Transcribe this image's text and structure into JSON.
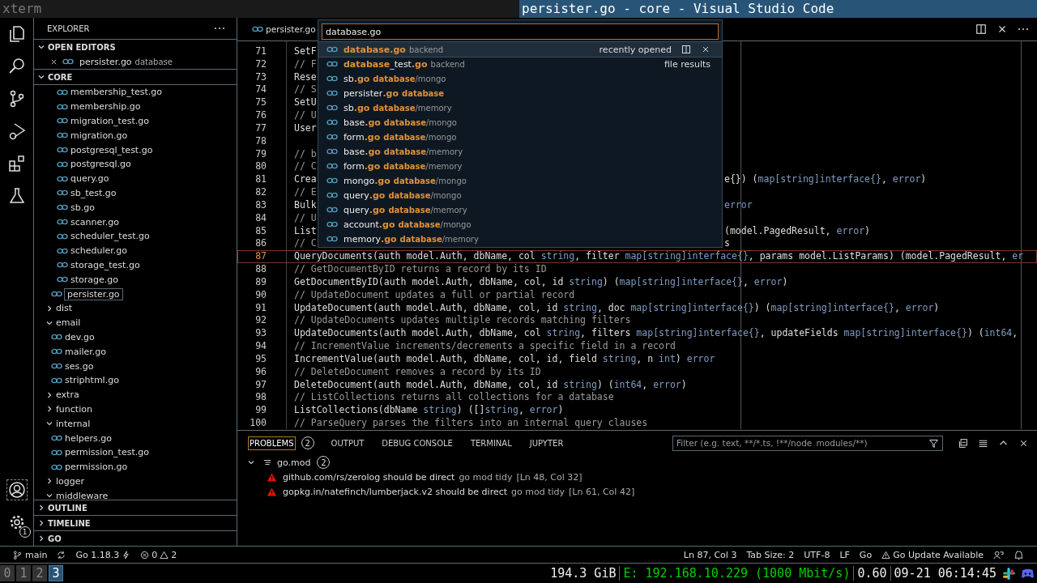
{
  "top_bar": {
    "app": "xterm",
    "title": "persister.go - core - Visual Studio Code"
  },
  "activity_bar": {
    "settings_badge": "1"
  },
  "sidebar": {
    "title": "EXPLORER",
    "open_editors": {
      "label": "OPEN EDITORS",
      "expanded": true,
      "items": [
        {
          "name": "persister.go",
          "folder": "database"
        }
      ]
    },
    "workspace": {
      "label": "CORE",
      "expanded": true,
      "tree": [
        {
          "children": [
            {
              "children": [
                {
                  "kind": "file",
                  "name": "membership_test.go",
                  "selected": false
                },
                {
                  "kind": "file",
                  "name": "membership.go",
                  "selected": false
                },
                {
                  "kind": "file",
                  "name": "migration_test.go",
                  "selected": false
                },
                {
                  "kind": "file",
                  "name": "migration.go",
                  "selected": false
                },
                {
                  "kind": "file",
                  "name": "postgresql_test.go",
                  "selected": false
                },
                {
                  "kind": "file",
                  "name": "postgresql.go",
                  "selected": false
                },
                {
                  "kind": "file",
                  "name": "query.go",
                  "selected": false
                },
                {
                  "kind": "file",
                  "name": "sb_test.go",
                  "selected": false
                },
                {
                  "kind": "file",
                  "name": "sb.go",
                  "selected": false
                },
                {
                  "kind": "file",
                  "name": "scanner.go",
                  "selected": false
                },
                {
                  "kind": "file",
                  "name": "scheduler_test.go",
                  "selected": false
                },
                {
                  "kind": "file",
                  "name": "scheduler.go",
                  "selected": false
                },
                {
                  "kind": "file",
                  "name": "storage_test.go",
                  "selected": false
                },
                {
                  "kind": "file",
                  "name": "storage.go",
                  "selected": false
                }
              ]
            },
            {
              "kind": "file",
              "name": "persister.go",
              "selected": true
            }
          ]
        },
        {
          "kind": "folder",
          "name": "dist",
          "expanded": false,
          "selected": false
        },
        {
          "kind": "folder",
          "name": "email",
          "expanded": true,
          "selected": false,
          "children": [
            {
              "kind": "file",
              "name": "dev.go",
              "selected": false
            },
            {
              "kind": "file",
              "name": "mailer.go",
              "selected": false
            },
            {
              "kind": "file",
              "name": "ses.go",
              "selected": false
            },
            {
              "kind": "file",
              "name": "striphtml.go",
              "selected": false
            }
          ]
        },
        {
          "kind": "folder",
          "name": "extra",
          "expanded": false,
          "selected": false
        },
        {
          "kind": "folder",
          "name": "function",
          "expanded": false,
          "selected": false
        },
        {
          "kind": "folder",
          "name": "internal",
          "expanded": true,
          "selected": false,
          "children": [
            {
              "kind": "file",
              "name": "helpers.go",
              "selected": false
            },
            {
              "kind": "file",
              "name": "permission_test.go",
              "selected": false
            },
            {
              "kind": "file",
              "name": "permission.go",
              "selected": false
            }
          ]
        },
        {
          "kind": "folder",
          "name": "logger",
          "expanded": false,
          "selected": false
        },
        {
          "kind": "folder",
          "name": "middleware",
          "expanded": true,
          "selected": false
        }
      ]
    },
    "sections": [
      {
        "label": "OUTLINE",
        "expanded": false
      },
      {
        "label": "TIMELINE",
        "expanded": false
      },
      {
        "label": "GO",
        "expanded": false
      }
    ]
  },
  "editor": {
    "tab": "persister.go",
    "lines": [
      {
        "number": "71",
        "kind": "code",
        "current": false,
        "tokens": [
          {
            "t": "SetF"
          }
        ]
      },
      {
        "number": "72",
        "kind": "comment",
        "current": false,
        "tokens": [
          {
            "t": "// F"
          }
        ]
      },
      {
        "number": "73",
        "kind": "code",
        "current": false,
        "tokens": [
          {
            "t": "Rese"
          }
        ]
      },
      {
        "number": "74",
        "kind": "comment",
        "current": false,
        "tokens": [
          {
            "t": "// S"
          }
        ]
      },
      {
        "number": "75",
        "kind": "code",
        "current": false,
        "tokens": [
          {
            "t": "SetU"
          }
        ]
      },
      {
        "number": "76",
        "kind": "comment",
        "current": false,
        "tokens": [
          {
            "t": "// U"
          }
        ]
      },
      {
        "number": "77",
        "kind": "code",
        "current": false,
        "tokens": [
          {
            "t": "User"
          }
        ]
      },
      {
        "number": "78",
        "current": false
      },
      {
        "number": "79",
        "kind": "comment",
        "current": false,
        "tokens": [
          {
            "t": "// b"
          }
        ]
      },
      {
        "number": "80",
        "kind": "comment",
        "current": false,
        "tokens": [
          {
            "t": "// C"
          }
        ]
      },
      {
        "number": "81",
        "kind": "code",
        "current": false,
        "tokens": [
          {
            "t": "Crea"
          }
        ],
        "tail": [
          {
            "t": "e{}) ("
          },
          {
            "t": "map[string]interface{}",
            "kind": "type"
          },
          {
            "t": ", "
          },
          {
            "t": "error",
            "kind": "type"
          },
          {
            "t": ")"
          }
        ]
      },
      {
        "number": "82",
        "kind": "comment",
        "current": false,
        "tokens": [
          {
            "t": "// E"
          }
        ]
      },
      {
        "number": "83",
        "kind": "code",
        "current": false,
        "tokens": [
          {
            "t": "Bulk"
          }
        ],
        "tail": [
          {
            "t": "error",
            "kind": "type"
          }
        ]
      },
      {
        "number": "84",
        "kind": "comment",
        "current": false,
        "tokens": [
          {
            "t": "// U"
          }
        ]
      },
      {
        "number": "85",
        "kind": "code",
        "current": false,
        "tokens": [
          {
            "t": "List"
          }
        ],
        "tail": [
          {
            "t": "(model.PagedResult, "
          },
          {
            "t": "error",
            "kind": "type"
          },
          {
            "t": ")"
          }
        ]
      },
      {
        "number": "86",
        "kind": "comment",
        "current": false,
        "tokens": [
          {
            "t": "// C"
          }
        ],
        "tail": [
          {
            "t": "s"
          }
        ]
      },
      {
        "number": "87",
        "kind": "code",
        "current": true,
        "tokens": [
          {
            "t": "QueryDocuments(auth model.Auth, dbName, col "
          },
          {
            "t": "string",
            "kind": "type"
          },
          {
            "t": ", filter "
          },
          {
            "t": "map[string]interface{}",
            "kind": "type"
          },
          {
            "t": ", params model.ListParams) (model.PagedResult, "
          },
          {
            "t": "er",
            "kind": "type"
          }
        ]
      },
      {
        "number": "88",
        "kind": "comment",
        "current": false,
        "tokens": [
          {
            "t": "// GetDocumentByID returns a record by its ID"
          }
        ]
      },
      {
        "number": "89",
        "kind": "code",
        "current": false,
        "tokens": [
          {
            "t": "GetDocumentByID(auth model.Auth, dbName, col, id "
          },
          {
            "t": "string",
            "kind": "type"
          },
          {
            "t": ") ("
          },
          {
            "t": "map[string]interface{}",
            "kind": "type"
          },
          {
            "t": ", "
          },
          {
            "t": "error",
            "kind": "type"
          },
          {
            "t": ")"
          }
        ]
      },
      {
        "number": "90",
        "kind": "comment",
        "current": false,
        "tokens": [
          {
            "t": "// UpdateDocument updates a full or partial record"
          }
        ]
      },
      {
        "number": "91",
        "kind": "code",
        "current": false,
        "tokens": [
          {
            "t": "UpdateDocument(auth model.Auth, dbName, col, id "
          },
          {
            "t": "string",
            "kind": "type"
          },
          {
            "t": ", doc "
          },
          {
            "t": "map[string]interface{}",
            "kind": "type"
          },
          {
            "t": ") ("
          },
          {
            "t": "map[string]interface{}",
            "kind": "type"
          },
          {
            "t": ", "
          },
          {
            "t": "error",
            "kind": "type"
          },
          {
            "t": ")"
          }
        ]
      },
      {
        "number": "92",
        "kind": "comment",
        "current": false,
        "tokens": [
          {
            "t": "// UpdateDocuments updates multiple records matching filters"
          }
        ]
      },
      {
        "number": "93",
        "kind": "code",
        "current": false,
        "tokens": [
          {
            "t": "UpdateDocuments(auth model.Auth, dbName, col "
          },
          {
            "t": "string",
            "kind": "type"
          },
          {
            "t": ", filters "
          },
          {
            "t": "map[string]interface{}",
            "kind": "type"
          },
          {
            "t": ", updateFields "
          },
          {
            "t": "map[string]interface{}",
            "kind": "type"
          },
          {
            "t": ") ("
          },
          {
            "t": "int64",
            "kind": "type"
          },
          {
            "t": ","
          }
        ]
      },
      {
        "number": "94",
        "kind": "comment",
        "current": false,
        "tokens": [
          {
            "t": "// IncrementValue increments/decrements a specific field in a record"
          }
        ]
      },
      {
        "number": "95",
        "kind": "code",
        "current": false,
        "tokens": [
          {
            "t": "IncrementValue(auth model.Auth, dbName, col, id, field "
          },
          {
            "t": "string",
            "kind": "type"
          },
          {
            "t": ", n "
          },
          {
            "t": "int",
            "kind": "type"
          },
          {
            "t": ") "
          },
          {
            "t": "error",
            "kind": "type"
          }
        ]
      },
      {
        "number": "96",
        "kind": "comment",
        "current": false,
        "tokens": [
          {
            "t": "// DeleteDocument removes a record by its ID"
          }
        ]
      },
      {
        "number": "97",
        "kind": "code",
        "current": false,
        "tokens": [
          {
            "t": "DeleteDocument(auth model.Auth, dbName, col, id "
          },
          {
            "t": "string",
            "kind": "type"
          },
          {
            "t": ") ("
          },
          {
            "t": "int64",
            "kind": "type"
          },
          {
            "t": ", "
          },
          {
            "t": "error",
            "kind": "type"
          },
          {
            "t": ")"
          }
        ]
      },
      {
        "number": "98",
        "kind": "comment",
        "current": false,
        "tokens": [
          {
            "t": "// ListCollections returns all collections for a database"
          }
        ]
      },
      {
        "number": "99",
        "kind": "code",
        "current": false,
        "tokens": [
          {
            "t": "ListCollections(dbName "
          },
          {
            "t": "string",
            "kind": "type"
          },
          {
            "t": ") ([]"
          },
          {
            "t": "string",
            "kind": "type"
          },
          {
            "t": ", "
          },
          {
            "t": "error",
            "kind": "type"
          },
          {
            "t": ")"
          }
        ]
      },
      {
        "number": "100",
        "kind": "comment",
        "current": false,
        "tokens": [
          {
            "t": "// ParseQuery parses the filters into an internal query clauses"
          }
        ]
      }
    ]
  },
  "quick_open": {
    "value": "database.go",
    "results": [
      {
        "name": "**database.go**",
        "path": "backend",
        "selected": true,
        "group": "recently opened"
      },
      {
        "name": "**database**_test**.go**",
        "path": "backend",
        "selected": false,
        "group": "file results"
      },
      {
        "name": "sb**.go**",
        "path": "**database**/mongo",
        "selected": false
      },
      {
        "name": "persister**.go**",
        "path": "**database**",
        "selected": false
      },
      {
        "name": "sb**.go**",
        "path": "**database**/memory",
        "selected": false
      },
      {
        "name": "base**.go**",
        "path": "**database**/mongo",
        "selected": false
      },
      {
        "name": "form**.go**",
        "path": "**database**/mongo",
        "selected": false
      },
      {
        "name": "base**.go**",
        "path": "**database**/memory",
        "selected": false
      },
      {
        "name": "form**.go**",
        "path": "**database**/memory",
        "selected": false
      },
      {
        "name": "mongo**.go**",
        "path": "**database**/mongo",
        "selected": false
      },
      {
        "name": "query**.go**",
        "path": "**database**/mongo",
        "selected": false
      },
      {
        "name": "query**.go**",
        "path": "**database**/memory",
        "selected": false
      },
      {
        "name": "account**.go**",
        "path": "**database**/mongo",
        "selected": false
      },
      {
        "name": "memory**.go**",
        "path": "**database**/memory",
        "selected": false
      }
    ]
  },
  "panel": {
    "tabs": [
      {
        "label": "PROBLEMS",
        "badge": "2",
        "selected": true
      },
      {
        "label": "OUTPUT",
        "selected": false
      },
      {
        "label": "DEBUG CONSOLE",
        "selected": false
      },
      {
        "label": "TERMINAL",
        "selected": false
      },
      {
        "label": "JUPYTER",
        "selected": false
      }
    ],
    "filter_placeholder": "Filter (e.g. text, **/*.ts, !**/node_modules/**)",
    "problems": {
      "file": "go.mod",
      "count": "2",
      "expanded": true,
      "items": [
        {
          "message": "github.com/rs/zerolog should be direct",
          "source": "go mod tidy",
          "position": "[Ln 48, Col 32]"
        },
        {
          "message": "gopkg.in/natefinch/lumberjack.v2 should be direct",
          "source": "go mod tidy",
          "position": "[Ln 61, Col 42]"
        }
      ]
    }
  },
  "status_bar": {
    "branch": "main",
    "go_version": "Go 1.18.3",
    "errors": "0",
    "warnings": "2",
    "right": [
      "Ln 87, Col 3",
      "Tab Size: 2",
      "UTF-8",
      "LF",
      "Go"
    ],
    "update": "Go Update Available"
  },
  "i3bar": {
    "workspaces": [
      {
        "label": "0",
        "selected": false
      },
      {
        "label": "1",
        "selected": false
      },
      {
        "label": "2",
        "selected": false
      },
      {
        "label": "3",
        "selected": true
      }
    ],
    "disk": "194.3 GiB",
    "network": "E: 192.168.10.229 (1000 Mbit/s)",
    "load": "0.60",
    "datetime": "09-21 06:14:45"
  }
}
